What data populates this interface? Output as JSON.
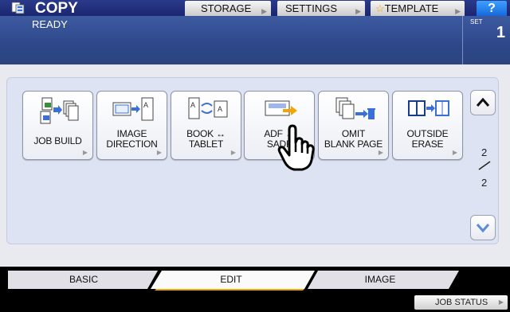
{
  "header": {
    "title": "COPY",
    "buttons": [
      {
        "label": "STORAGE"
      },
      {
        "label": "SETTINGS"
      },
      {
        "label": "TEMPLATE"
      }
    ],
    "help_label": "?"
  },
  "status": {
    "text": "READY",
    "set_label": "SET",
    "set_count": "1"
  },
  "functions": [
    {
      "line1": "JOB BUILD",
      "line2": ""
    },
    {
      "line1": "IMAGE",
      "line2": "DIRECTION"
    },
    {
      "line1": "BOOK ↔",
      "line2": "TABLET"
    },
    {
      "line1": "ADF →",
      "line2": "SADF"
    },
    {
      "line1": "OMIT",
      "line2": "BLANK PAGE"
    },
    {
      "line1": "OUTSIDE",
      "line2": "ERASE"
    }
  ],
  "pager": {
    "current": "2",
    "total": "2"
  },
  "tabs": [
    {
      "label": "BASIC"
    },
    {
      "label": "EDIT"
    },
    {
      "label": "IMAGE"
    }
  ],
  "footer": {
    "job_status": "JOB STATUS"
  },
  "icons": {
    "app": "copy-icon",
    "template_star": "star-icon",
    "scroll_up": "chevron-up-icon",
    "scroll_down": "chevron-down-icon",
    "pointer": "hand-pointer-icon"
  },
  "colors": {
    "header_blue": "#1a2670",
    "status_blue": "#2e478a",
    "active_tab": "#f0a500",
    "help_blue": "#1466d8"
  }
}
